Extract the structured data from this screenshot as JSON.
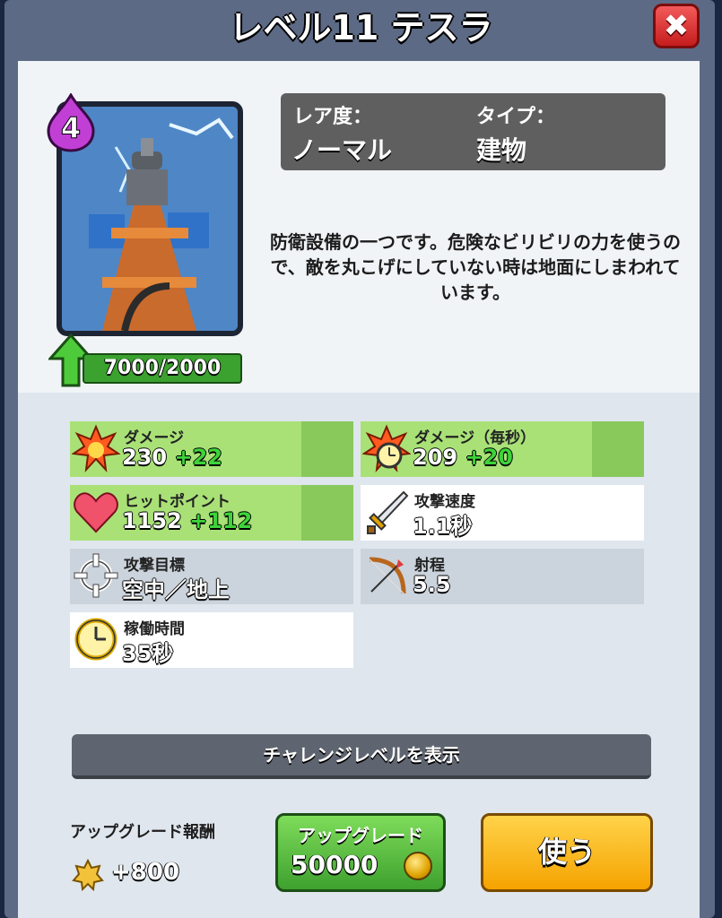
{
  "header": {
    "title": "レベル11 テスラ",
    "close_label": "✖"
  },
  "card": {
    "elixir_cost": "4",
    "progress": "7000/2000"
  },
  "info": {
    "rarity_label": "レア度：",
    "rarity_value": "ノーマル",
    "type_label": "タイプ：",
    "type_value": "建物"
  },
  "description": "防衛設備の一つです。危険なビリビリの力を使うので、敵を丸こげにしていない時は地面にしまわれています。",
  "stats": [
    {
      "label": "ダメージ",
      "value": "230",
      "bonus": "+22",
      "icon": "explosion-icon"
    },
    {
      "label": "ダメージ（毎秒）",
      "value": "209",
      "bonus": "+20",
      "icon": "explosion-clock-icon"
    },
    {
      "label": "ヒットポイント",
      "value": "1152",
      "bonus": "+112",
      "icon": "heart-icon"
    },
    {
      "label": "攻撃速度",
      "value": "1.1秒",
      "icon": "sword-icon"
    },
    {
      "label": "攻撃目標",
      "value": "空中／地上",
      "icon": "crosshair-icon"
    },
    {
      "label": "射程",
      "value": "5.5",
      "icon": "bow-icon"
    },
    {
      "label": "稼働時間",
      "value": "35秒",
      "icon": "clock-icon"
    }
  ],
  "challenge_button": "チャレンジレベルを表示",
  "reward": {
    "label": "アップグレード報酬",
    "value": "+800",
    "icon": "star-icon"
  },
  "upgrade_button": {
    "label": "アップグレード",
    "cost": "50000",
    "icon": "gold-coin-icon"
  },
  "use_button": "使う",
  "colors": {
    "green_stat": "#a9e177",
    "grey_stat": "#cbd3dc",
    "upgrade_green": "#3ea12e",
    "use_orange": "#f5a300",
    "close_red": "#c51d1d"
  }
}
